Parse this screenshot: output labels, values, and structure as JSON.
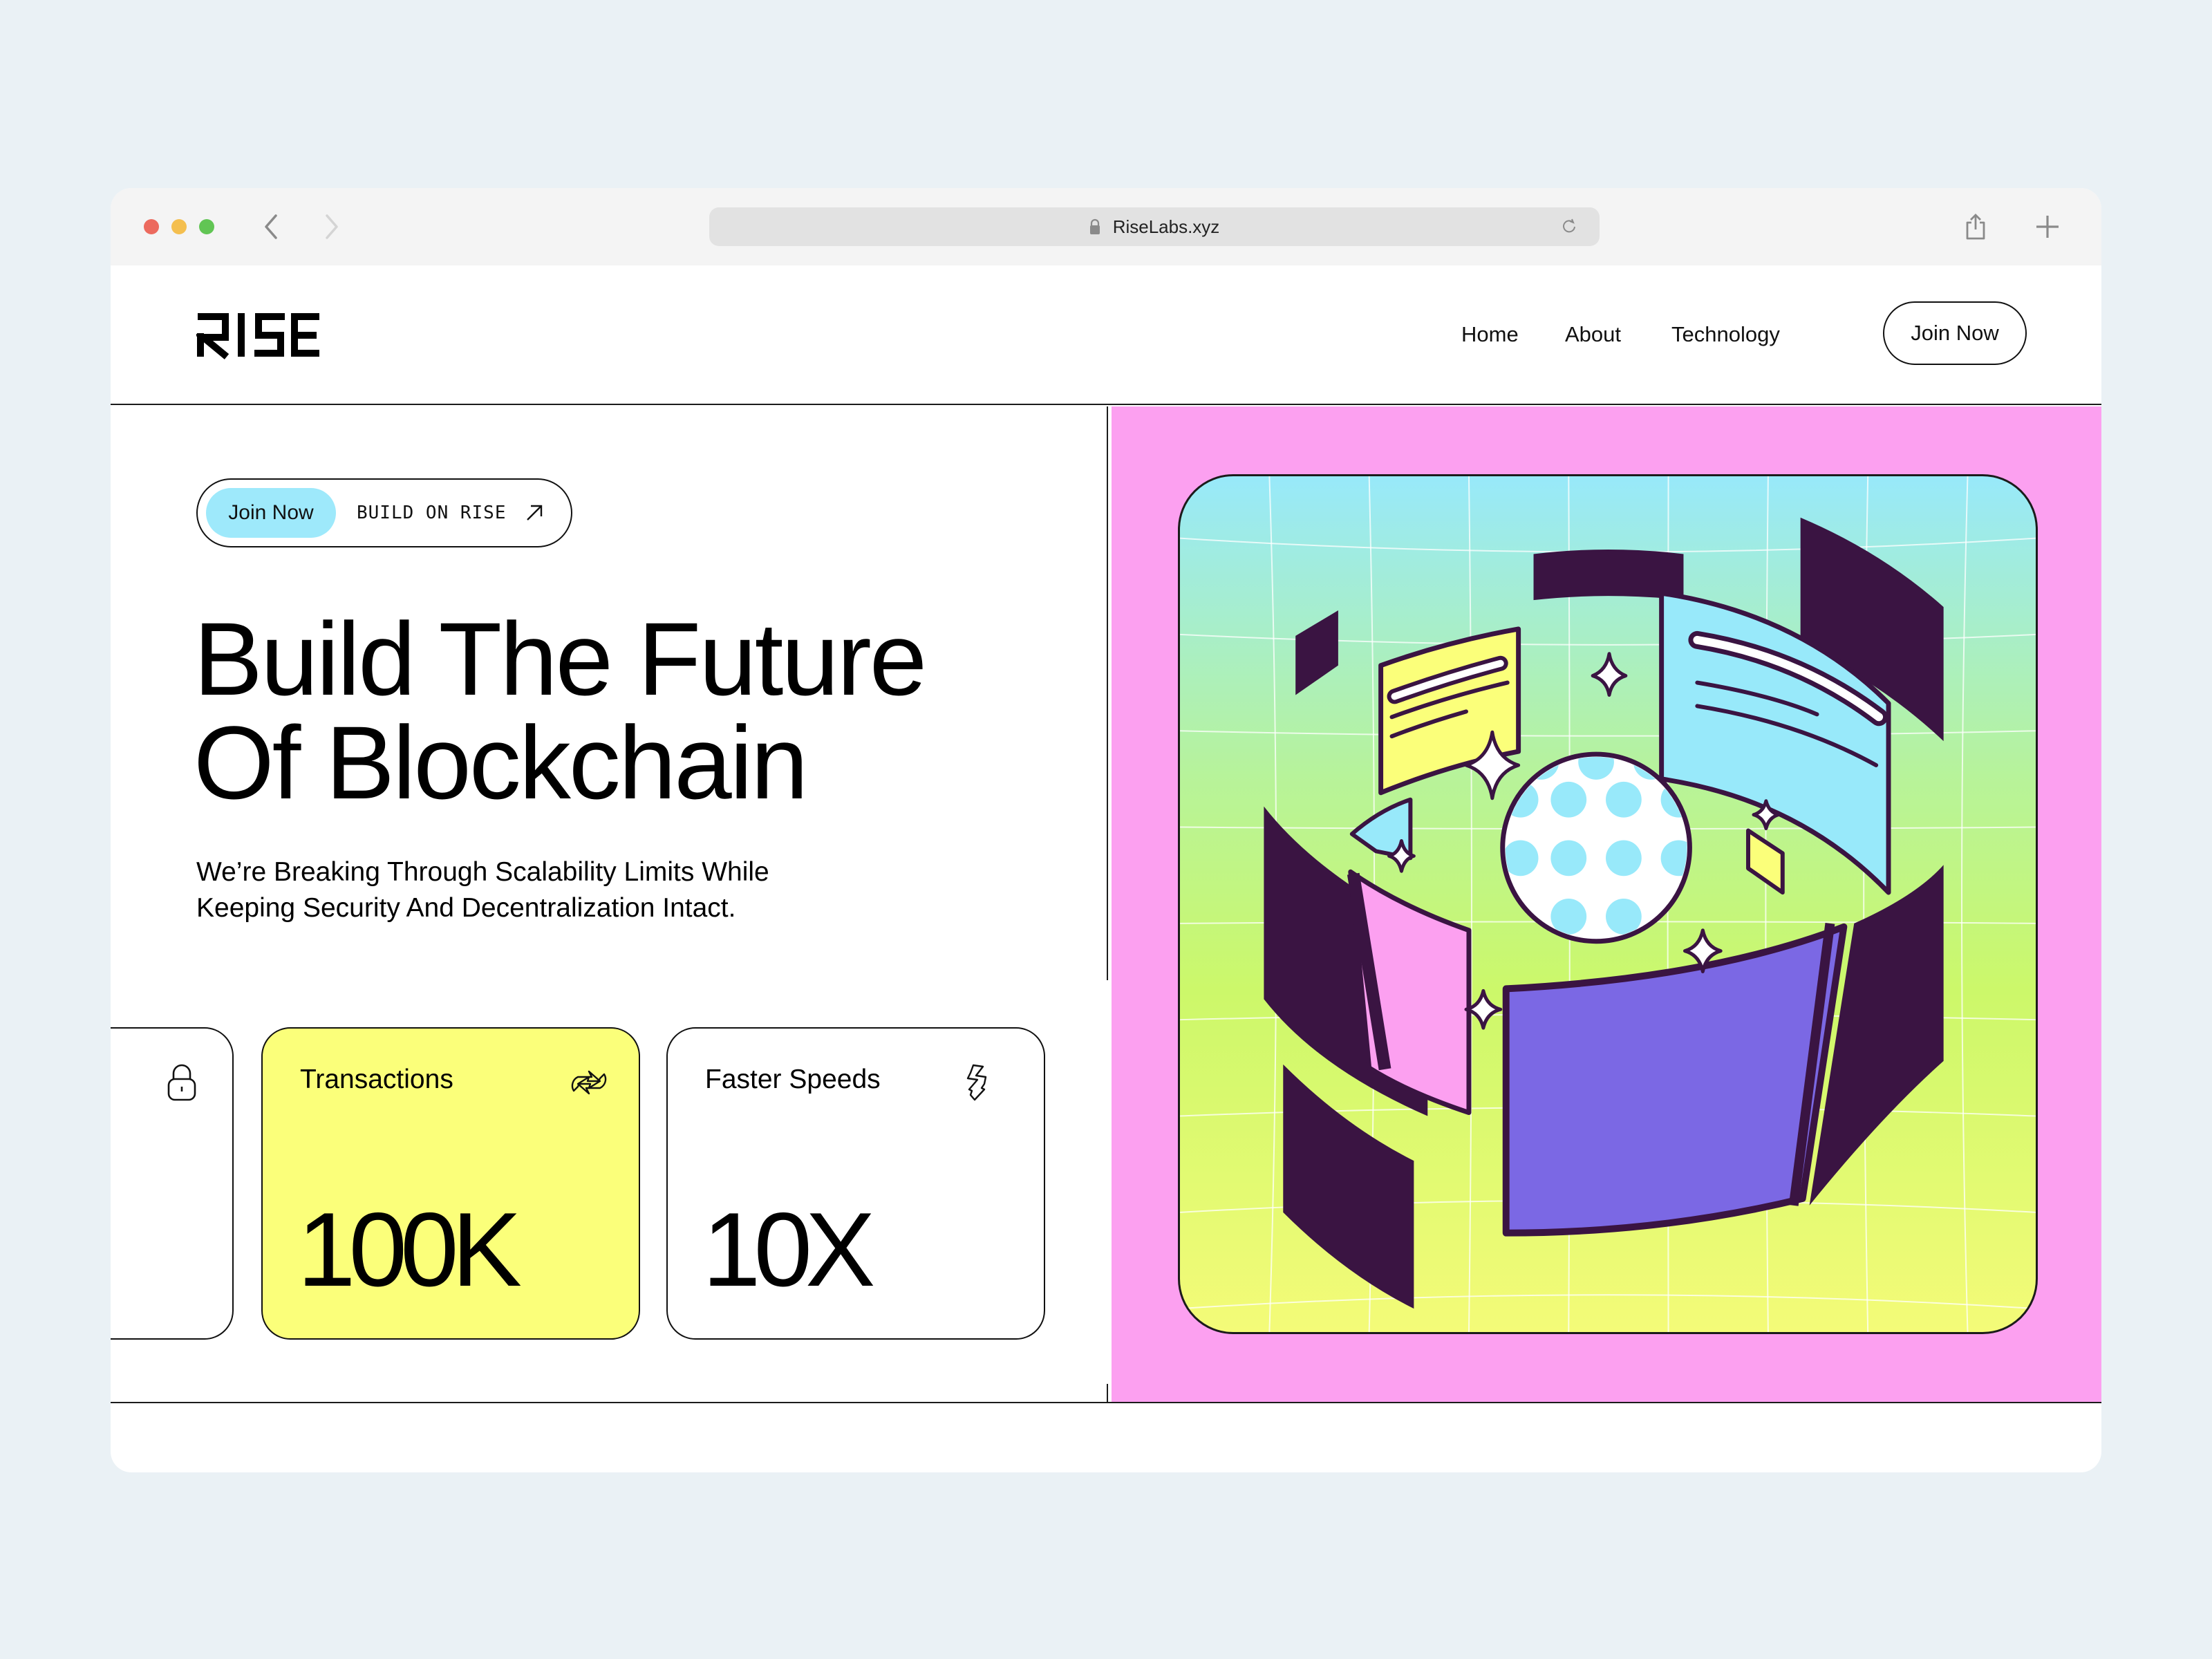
{
  "browser": {
    "url": "RiseLabs.xyz",
    "icons": [
      "close-dot",
      "minimize-dot",
      "maximize-dot",
      "back-icon",
      "forward-icon",
      "lock-icon",
      "reload-icon",
      "share-icon",
      "new-tab-icon"
    ]
  },
  "header": {
    "logo": "RISE",
    "nav": [
      {
        "label": "Home"
      },
      {
        "label": "About"
      },
      {
        "label": "Technology"
      }
    ],
    "cta": "Join Now"
  },
  "hero": {
    "pill": {
      "button": "Join Now",
      "text": "BUILD ON RISE",
      "icon": "arrow-up-right-icon"
    },
    "headline": [
      "Build The Future",
      "Of Blockchain"
    ],
    "subtext": [
      "We’re Breaking Through Scalability Limits While",
      "Keeping Security And Decentralization Intact."
    ],
    "cards": [
      {
        "label": "",
        "value": "",
        "icon": "lock-icon"
      },
      {
        "label": "Transactions",
        "value": "100K",
        "icon": "exchange-icon"
      },
      {
        "label": "Faster Speeds",
        "value": "10X",
        "icon": "lightning-icon"
      }
    ]
  },
  "colors": {
    "accent_cyan": "#9ee9fb",
    "card_yellow": "#fbff7a",
    "panel_pink": "#fca0f0",
    "art_purple": "#7b68e4",
    "art_dark": "#3a1442"
  }
}
